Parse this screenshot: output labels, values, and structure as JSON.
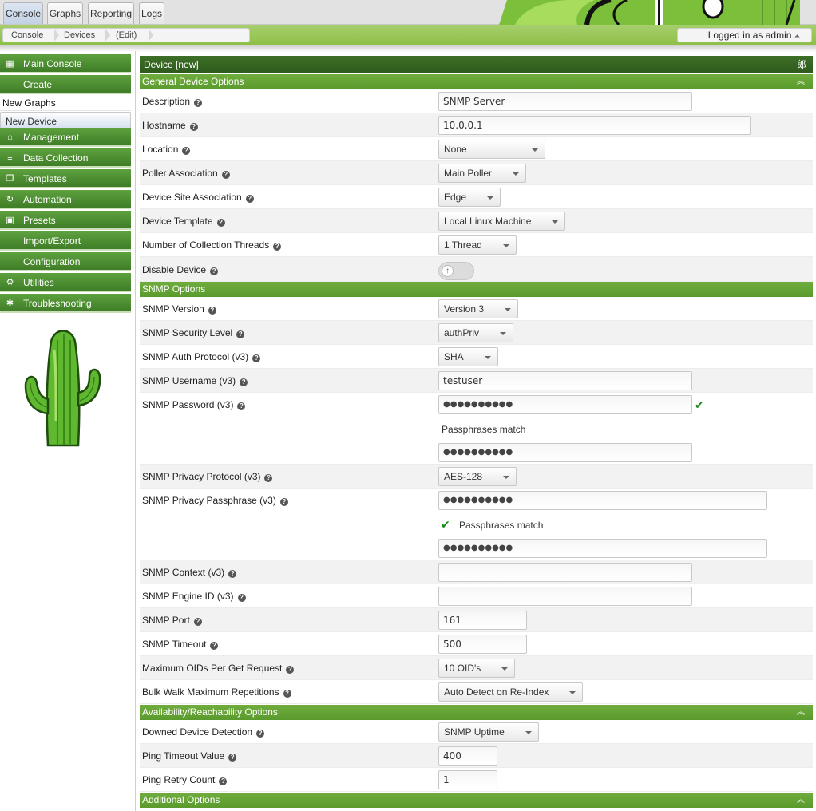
{
  "tabs": [
    "Console",
    "Graphs",
    "Reporting",
    "Logs"
  ],
  "breadcrumb": [
    "Console",
    "Devices",
    "(Edit)"
  ],
  "login": {
    "text": "Logged in as admin",
    "caret": "⏶"
  },
  "sidebar": {
    "main_console": "Main Console",
    "create": "Create",
    "new_graphs": "New Graphs",
    "new_device": "New Device",
    "management": "Management",
    "data_collection": "Data Collection",
    "templates": "Templates",
    "automation": "Automation",
    "presets": "Presets",
    "import_export": "Import/Export",
    "configuration": "Configuration",
    "utilities": "Utilities",
    "troubleshooting": "Troubleshooting"
  },
  "form": {
    "title": "Device [new]",
    "title_icon": "郎",
    "sections": {
      "general": "General Device Options",
      "snmp": "SNMP Options",
      "availability": "Availability/Reachability Options",
      "additional": "Additional Options"
    },
    "labels": {
      "description": "Description",
      "hostname": "Hostname",
      "location": "Location",
      "poller": "Poller Association",
      "site": "Device Site Association",
      "template": "Device Template",
      "threads": "Number of Collection Threads",
      "disable": "Disable Device",
      "snmp_version": "SNMP Version",
      "security_level": "SNMP Security Level",
      "auth_protocol": "SNMP Auth Protocol (v3)",
      "username": "SNMP Username (v3)",
      "password": "SNMP Password (v3)",
      "privacy_protocol": "SNMP Privacy Protocol (v3)",
      "privacy_pass": "SNMP Privacy Passphrase (v3)",
      "context": "SNMP Context (v3)",
      "engine_id": "SNMP Engine ID (v3)",
      "port": "SNMP Port",
      "timeout": "SNMP Timeout",
      "max_oids": "Maximum OIDs Per Get Request",
      "bulk_walk": "Bulk Walk Maximum Repetitions",
      "downed_detection": "Downed Device Detection",
      "ping_timeout": "Ping Timeout Value",
      "ping_retry": "Ping Retry Count"
    },
    "values": {
      "description": "SNMP Server",
      "hostname": "10.0.0.1",
      "location": "None",
      "poller": "Main Poller",
      "site": "Edge",
      "template": "Local Linux Machine",
      "threads": "1 Thread",
      "snmp_version": "Version 3",
      "security_level": "authPriv",
      "auth_protocol": "SHA",
      "username": "testuser",
      "password": "●●●●●●●●●●",
      "password_confirm": "●●●●●●●●●●",
      "privacy_protocol": "AES-128",
      "privacy_pass": "●●●●●●●●●●",
      "privacy_pass_confirm": "●●●●●●●●●●",
      "context": "",
      "engine_id": "",
      "port": "161",
      "timeout": "500",
      "max_oids": "10 OID's",
      "bulk_walk": "Auto Detect on Re-Index",
      "downed_detection": "SNMP Uptime",
      "ping_timeout": "400",
      "ping_retry": "1"
    },
    "match_text": "Passphrases match",
    "help_glyph": "?",
    "check_glyph": "✔",
    "toggle_glyph": "↑",
    "collapse_glyph": "⌃"
  }
}
